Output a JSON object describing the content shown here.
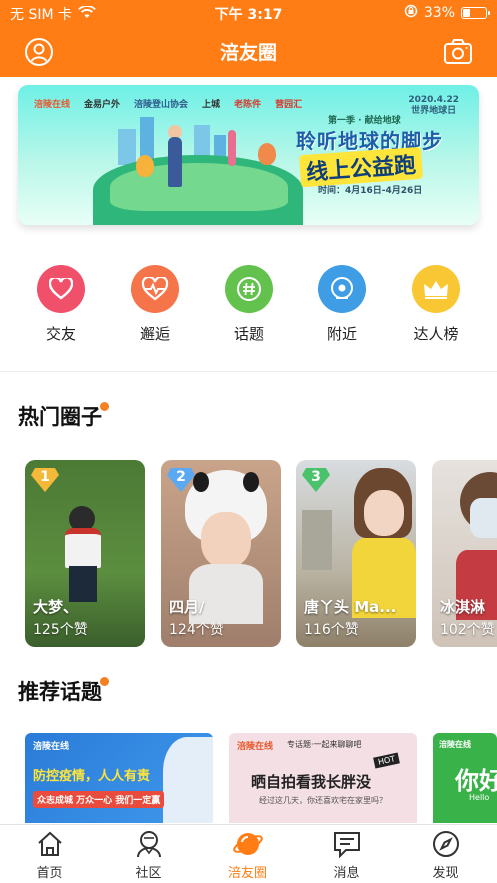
{
  "status_bar": {
    "carrier": "无 SIM 卡",
    "time": "下午 3:17",
    "battery_text": "33%",
    "battery_level": 0.33
  },
  "navbar": {
    "title": "涪友圈"
  },
  "banner": {
    "logos": [
      "涪陵在线",
      "金易户外",
      "涪陵登山协会",
      "上城",
      "老陈件",
      "营园汇"
    ],
    "date_line1": "2020.4.22",
    "date_line2": "世界地球日",
    "tagline": "第一季 · 献给地球",
    "headline1": "聆听地球的脚步",
    "headline2": "线上公益跑",
    "time_text": "时间：4月16日-4月26日"
  },
  "categories": [
    {
      "label": "交友",
      "icon": "heart-icon",
      "color": "#f0506a"
    },
    {
      "label": "邂逅",
      "icon": "heartbeat-icon",
      "color": "#f5744a"
    },
    {
      "label": "话题",
      "icon": "hashtag-icon",
      "color": "#63c24e"
    },
    {
      "label": "附近",
      "icon": "location-icon",
      "color": "#3f9de6"
    },
    {
      "label": "达人榜",
      "icon": "crown-icon",
      "color": "#f8c733"
    }
  ],
  "hot_circles": {
    "title": "热门圈子",
    "cards": [
      {
        "rank": "1",
        "name": "大梦、",
        "likes": "125个赞"
      },
      {
        "rank": "2",
        "name": "四月/",
        "likes": "124个赞"
      },
      {
        "rank": "3",
        "name": "唐丫头 Ma...",
        "likes": "116个赞"
      },
      {
        "rank": "",
        "name": "冰淇淋",
        "likes": "102个赞"
      }
    ]
  },
  "topics": {
    "title": "推荐话题",
    "items": [
      {
        "brand": "涪陵在线",
        "headline": "防控疫情，人人有责",
        "slogan": "众志成城 万众一心 我们一定赢"
      },
      {
        "brand": "涪陵在线",
        "header": "专话题·一起来聊聊吧",
        "headline": "晒自拍看我长胖没",
        "sub": "经过这几天，你还喜欢宅在家里吗？",
        "badge": "HOT"
      },
      {
        "brand": "涪陵在线",
        "headline": "你好",
        "sub": "Hello"
      }
    ]
  },
  "tabbar": {
    "tabs": [
      {
        "label": "首页",
        "icon": "home-icon"
      },
      {
        "label": "社区",
        "icon": "community-icon"
      },
      {
        "label": "涪友圈",
        "icon": "planet-icon",
        "active": true
      },
      {
        "label": "消息",
        "icon": "message-icon"
      },
      {
        "label": "发现",
        "icon": "compass-icon"
      }
    ]
  },
  "colors": {
    "brand": "#ff7d14",
    "accent_dot": "#f58020"
  }
}
